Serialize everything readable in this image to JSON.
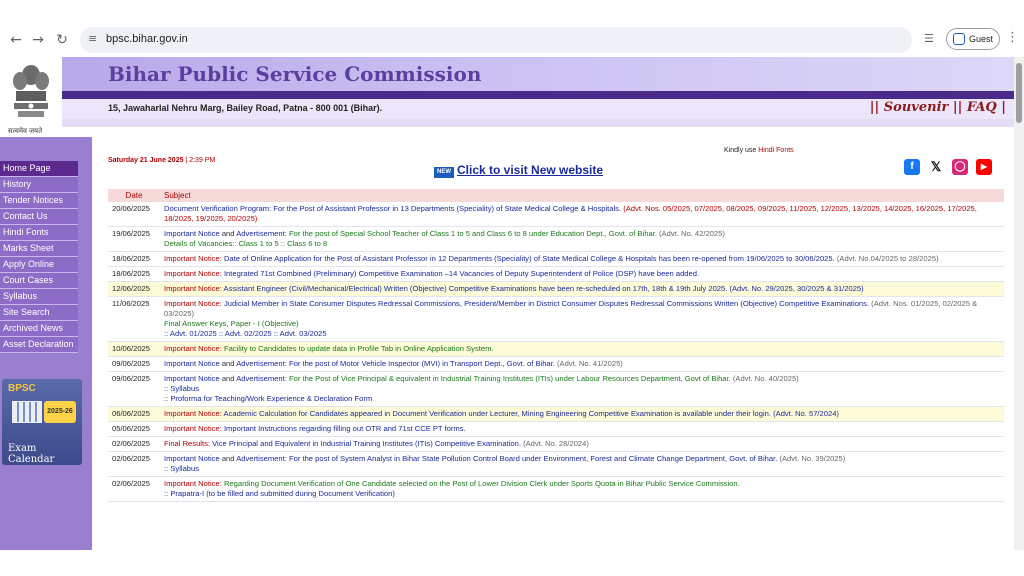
{
  "browser": {
    "url": "bpsc.bihar.gov.in",
    "profile_label": "Guest"
  },
  "header": {
    "title": "Bihar Public Service Commission",
    "address": "15, Jawaharlal Nehru Marg, Bailey Road, Patna - 800 001 (Bihar).",
    "links": "|| Souvenir || FAQ |",
    "motto": "सत्यमेव जयते"
  },
  "sidebar": {
    "items": [
      {
        "label": "Home Page"
      },
      {
        "label": "History"
      },
      {
        "label": "Tender Notices"
      },
      {
        "label": "Contact Us"
      },
      {
        "label": "Hindi Fonts"
      },
      {
        "label": "Marks Sheet"
      },
      {
        "label": "Apply Online"
      },
      {
        "label": "Court Cases"
      },
      {
        "label": "Syllabus"
      },
      {
        "label": "Site Search"
      },
      {
        "label": "Archived News"
      },
      {
        "label": "Asset Declaration"
      }
    ],
    "calendar": {
      "brand": "BPSC",
      "year": "2025-26",
      "label": "Exam Calendar"
    }
  },
  "main": {
    "date": "Saturday 21 June 2025",
    "time": "| 2:39 PM",
    "kindly_prefix": "Kindly use",
    "kindly_link": "Hindi Fonts",
    "new_badge": "NEW",
    "new_site": "Click to visit New website",
    "table": {
      "col_date": "Date",
      "col_subject": "Subject",
      "rows": [
        {
          "date": "20/06/2025",
          "hl": false,
          "parts": [
            {
              "c": "lbl",
              "t": "Document Verification Program: For the Post of Assistant Professor in 13 Departments (Speciality) of State Medical College & Hospitals."
            },
            {
              "c": "red",
              "t": " (Advt. Nos. 05/2025, 07/2025, 08/2025, 09/2025, 11/2025, 12/2025, 13/2025, 14/2025, 16/2025, 17/2025, 18/2025, 19/2025, 20/2025)"
            }
          ]
        },
        {
          "date": "19/06/2025",
          "hl": false,
          "parts": [
            {
              "c": "lbl",
              "t": "Important Notice"
            },
            {
              "c": "",
              "t": " and "
            },
            {
              "c": "lbl",
              "t": "Advertisement"
            },
            {
              "c": "grn",
              "t": ": For the post of Special School Teacher of Class 1 to 5 and Class 6 to 8 under Education Dept., Govt. of Bihar."
            },
            {
              "c": "adv",
              "t": " (Advt. No. 42/2025)"
            }
          ],
          "subs": [
            {
              "c": "g",
              "t": "Details of Vacancies:: Class 1 to 5 :: Class 6 to 8"
            }
          ]
        },
        {
          "date": "18/06/2025",
          "hl": false,
          "parts": [
            {
              "c": "red",
              "t": "Important Notice:"
            },
            {
              "c": "lbl",
              "t": " Date of Online Application for the Post of Assistant Professor in 12 Departments (Speciality) of State Medical College & Hospitals has been re-opened from 19/06/2025 to 30/06/2025."
            },
            {
              "c": "adv",
              "t": " (Advt. No.04/2025 to 28/2025)"
            }
          ]
        },
        {
          "date": "18/06/2025",
          "hl": false,
          "parts": [
            {
              "c": "red",
              "t": "Important Notice:"
            },
            {
              "c": "lbl",
              "t": " Integrated 71st Combined (Preliminary) Competitive Examination –14 Vacancies of Deputy Superintendent of Police (DSP) have been added."
            }
          ]
        },
        {
          "date": "12/06/2025",
          "hl": true,
          "parts": [
            {
              "c": "red",
              "t": "Important Notice:"
            },
            {
              "c": "lbl",
              "t": " Assistant Engineer (Civil/Mechanical/Electrical) Written (Objective) Competitive Examinations have been re-scheduled on 17th, 18th & 19th July 2025. (Advt. No. 29/2025, 30/2025 & 31/2025)"
            }
          ]
        },
        {
          "date": "11/06/2025",
          "hl": false,
          "parts": [
            {
              "c": "red",
              "t": "Important Notice:"
            },
            {
              "c": "lbl",
              "t": " Judicial Member in State Consumer Disputes Redressal Commissions, President/Member in District Consumer Disputes Redressal Commissions Written (Objective) Competitive Examinations."
            },
            {
              "c": "adv",
              "t": " (Advt. Nos. 01/2025, 02/2025 & 03/2025)"
            }
          ],
          "subs": [
            {
              "c": "g",
              "t": " "
            },
            {
              "c": "g",
              "t": "Final Answer Keys, Paper - I (Objective)"
            },
            {
              "c": "",
              "t": ":: Advt. 01/2025 :: Advt. 02/2025 :: Advt. 03/2025"
            }
          ]
        },
        {
          "date": "10/06/2025",
          "hl": true,
          "parts": [
            {
              "c": "red",
              "t": "Important Notice:"
            },
            {
              "c": "grn",
              "t": " Facility to Candidates to update data in Profile Tab in Online Application System."
            }
          ]
        },
        {
          "date": "09/06/2025",
          "hl": false,
          "parts": [
            {
              "c": "lbl",
              "t": "Important Notice"
            },
            {
              "c": "",
              "t": " and "
            },
            {
              "c": "lbl",
              "t": "Advertisement"
            },
            {
              "c": "lbl",
              "t": ": For the post of Motor Vehicle Inspector (MVI) in Transport Dept., Govt. of Bihar."
            },
            {
              "c": "adv",
              "t": " (Advt. No. 41/2025)"
            }
          ]
        },
        {
          "date": "09/06/2025",
          "hl": false,
          "parts": [
            {
              "c": "lbl",
              "t": "Important Notice"
            },
            {
              "c": "",
              "t": " and "
            },
            {
              "c": "lbl",
              "t": "Advertisement"
            },
            {
              "c": "grn",
              "t": ": For the Post of Vice Principal & equivalent in Industrial Training Institutes (ITIs) under Labour Resources Department, Govt of Bihar."
            },
            {
              "c": "adv",
              "t": " (Advt. No. 40/2025)"
            }
          ],
          "subs": [
            {
              "c": "",
              "t": " "
            },
            {
              "c": "",
              "t": ":: Syllabus"
            },
            {
              "c": "",
              "t": ":: Proforma for Teaching/Work Experience & Declaration Form"
            }
          ]
        },
        {
          "date": "06/06/2025",
          "hl": true,
          "parts": [
            {
              "c": "red",
              "t": "Important Notice:"
            },
            {
              "c": "lbl",
              "t": " Academic Calculation for Candidates appeared in Document Verification under Lecturer, Mining Engineering Competitive Examination is available under their login. (Advt. No. 57/2024)"
            }
          ]
        },
        {
          "date": "05/06/2025",
          "hl": false,
          "parts": [
            {
              "c": "red",
              "t": "Important Notice:"
            },
            {
              "c": "lbl",
              "t": " Important Instructions regarding filling out OTR and 71st CCE PT forms."
            }
          ]
        },
        {
          "date": "02/06/2025",
          "hl": false,
          "parts": [
            {
              "c": "red",
              "t": "Final Results:"
            },
            {
              "c": "lbl",
              "t": " Vice Principal and Equivalent in Industrial Training Institutes (ITIs) Competitive Examination."
            },
            {
              "c": "adv",
              "t": " (Advt. No. 28/2024)"
            }
          ]
        },
        {
          "date": "02/06/2025",
          "hl": false,
          "parts": [
            {
              "c": "lbl",
              "t": "Important Notice"
            },
            {
              "c": "",
              "t": " and "
            },
            {
              "c": "lbl",
              "t": "Advertisement"
            },
            {
              "c": "lbl",
              "t": ": For the post of System Analyst in Bihar State Pollution Control Board under Environment, Forest and Climate Change Department, Govt. of Bihar."
            },
            {
              "c": "adv",
              "t": " (Advt. No. 39/2025)"
            }
          ],
          "subs": [
            {
              "c": "",
              "t": ":: Syllabus"
            }
          ]
        },
        {
          "date": "02/06/2025",
          "hl": false,
          "parts": [
            {
              "c": "red",
              "t": "Important Notice:"
            },
            {
              "c": "grn",
              "t": " Regarding Document Verification of One Candidate selected on the Post of Lower Division Clerk under Sports Quota in Bihar Public Service Commission."
            }
          ],
          "subs": [
            {
              "c": "",
              "t": " "
            },
            {
              "c": "",
              "t": ":: Prapatra-I (to be filled and submitted during Document Verification)"
            }
          ]
        }
      ]
    }
  },
  "colors": {
    "sidebar": "#9a7fd0",
    "header_dark": "#4a2b8c",
    "title": "#5b3fa0",
    "active_menu": "#5c2a8f"
  },
  "icons": [
    "back-icon",
    "forward-icon",
    "reload-icon",
    "site-settings-icon",
    "cast-icon",
    "profile-icon",
    "menu-kebab-icon",
    "facebook-icon",
    "x-icon",
    "instagram-icon",
    "youtube-icon",
    "state-emblem-icon"
  ]
}
